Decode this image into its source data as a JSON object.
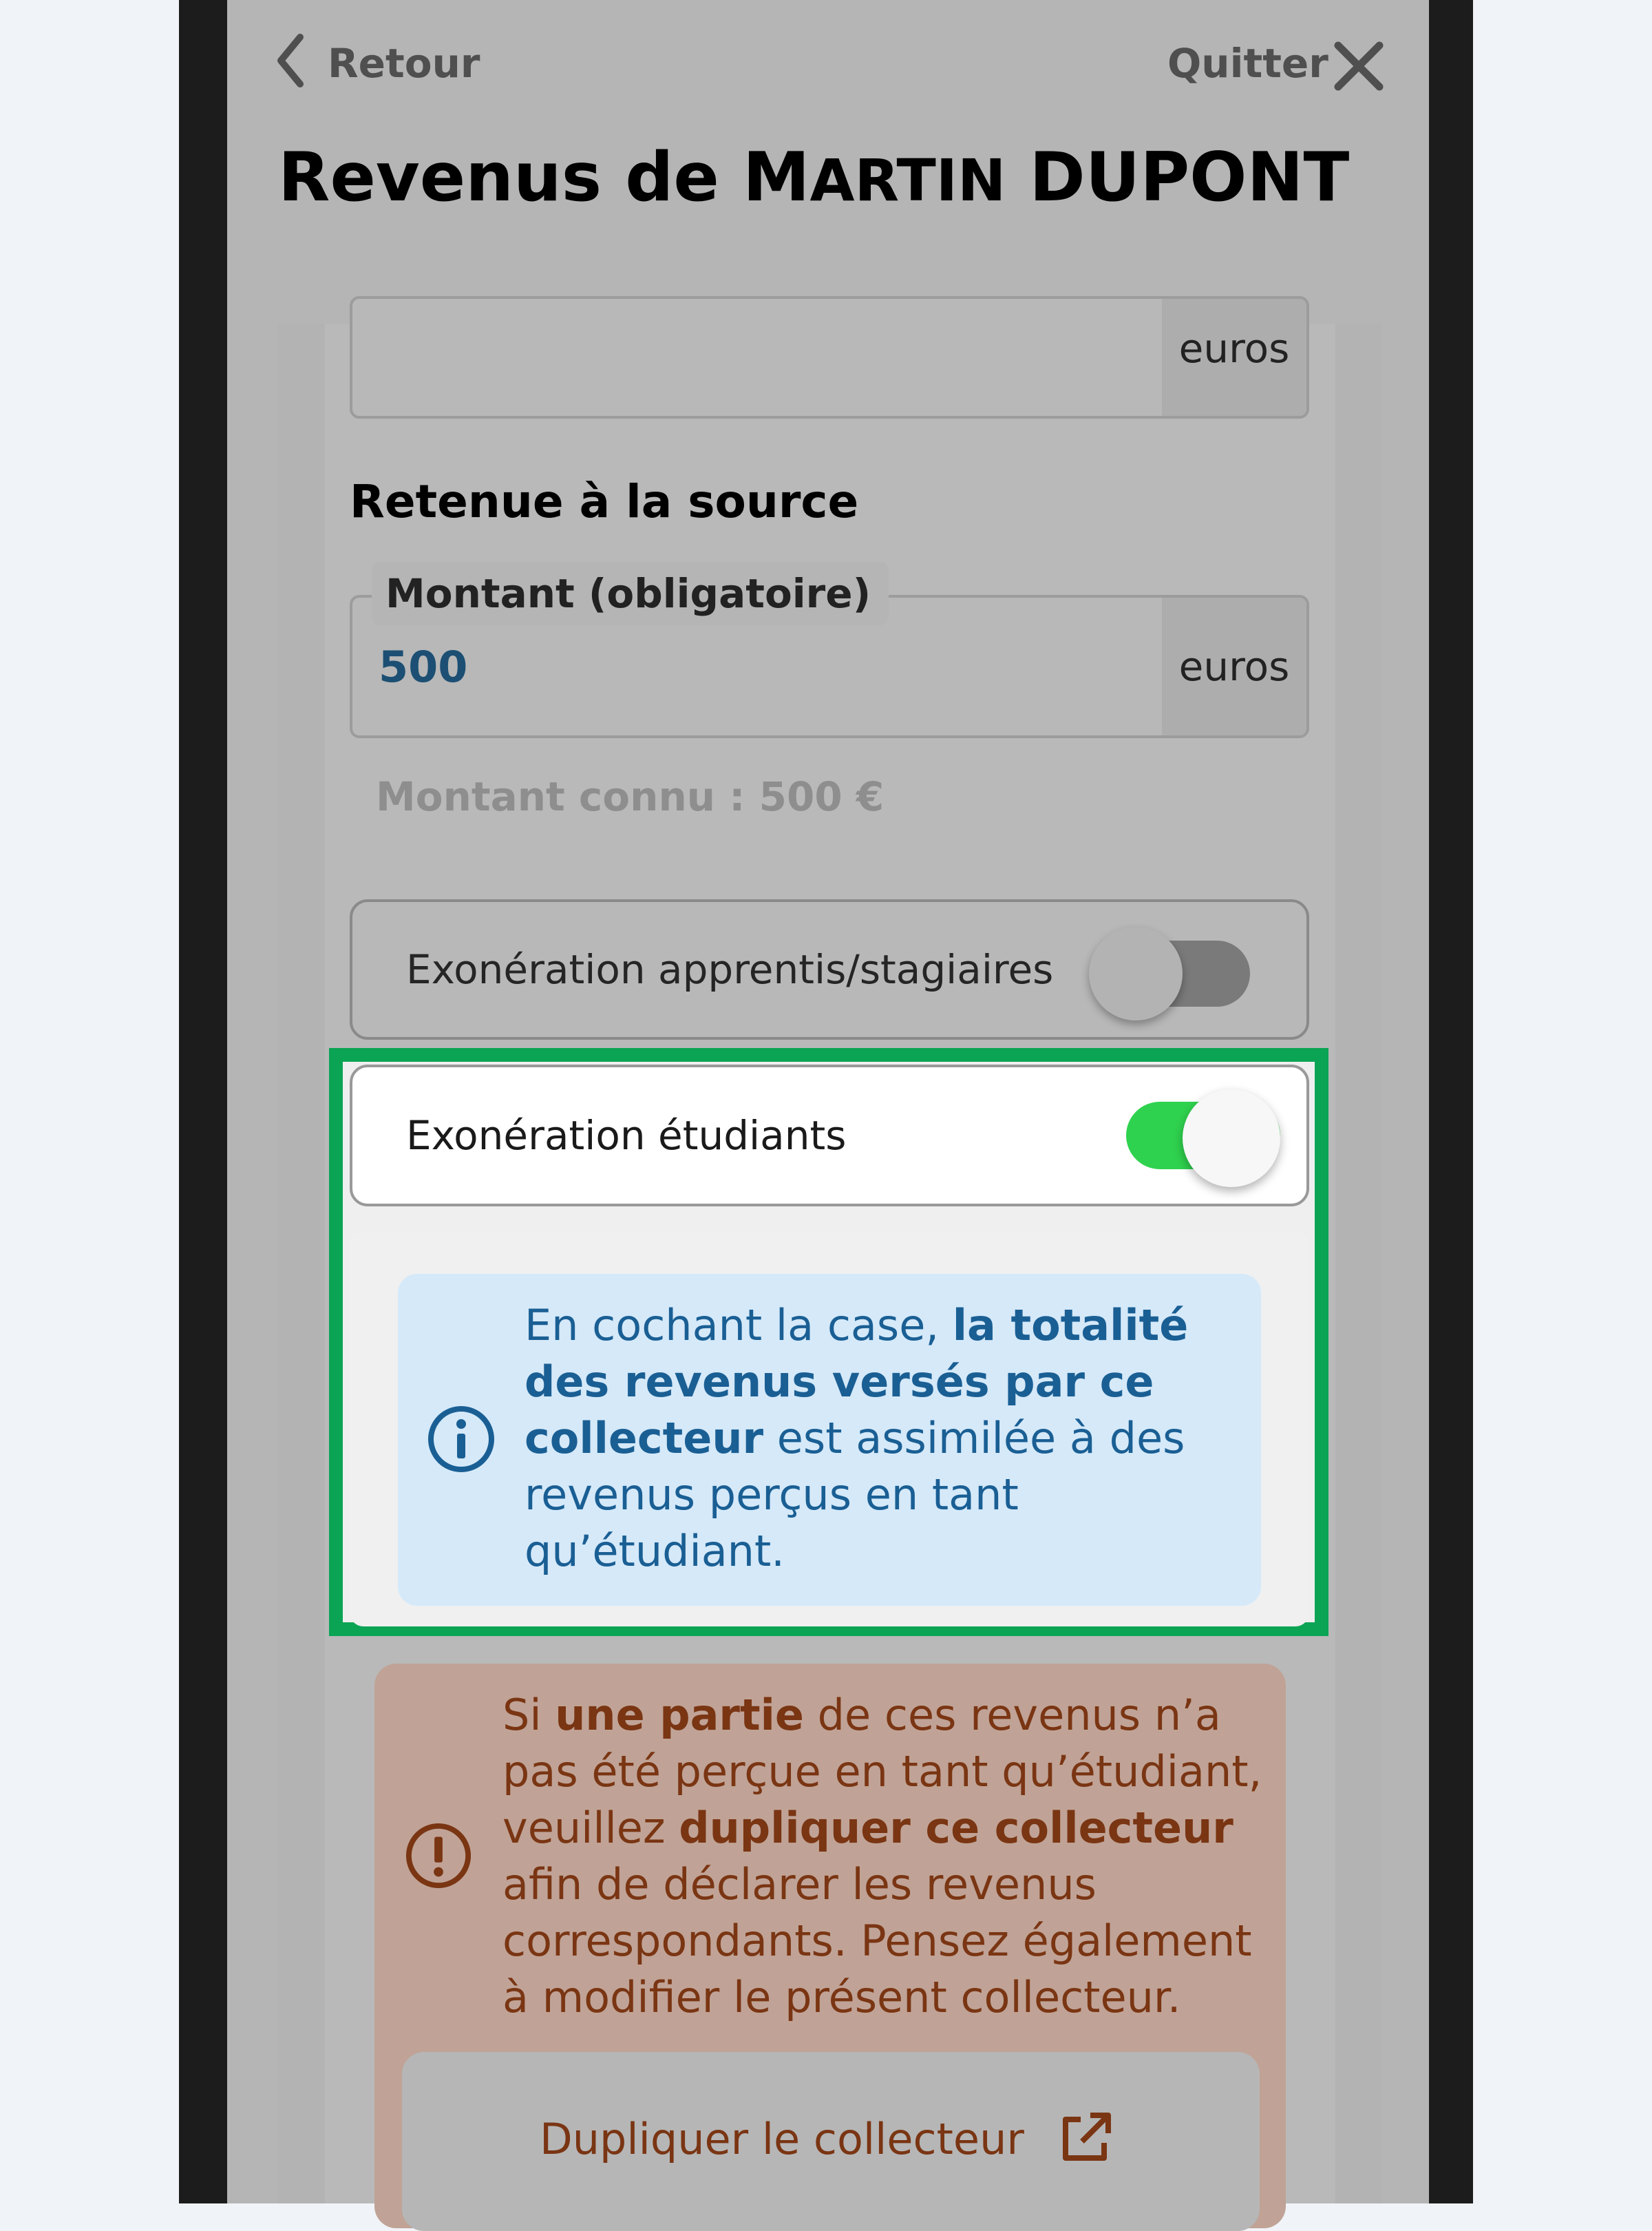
{
  "header": {
    "back_label": "Retour",
    "quit_label": "Quitter",
    "title_prefix": "Revenus de ",
    "title_first_initial": "M",
    "title_first_rest": "ARTIN",
    "title_last": " DUPONT"
  },
  "fields": {
    "unit": "euros",
    "section_title": "Retenue à la source",
    "amount_label": "Montant (obligatoire)",
    "amount_value": "500",
    "known_amount": "Montant connu : 500 €"
  },
  "toggles": [
    {
      "label": "Exonération apprentis/stagiaires",
      "on": false
    },
    {
      "label": "Exonération étudiants",
      "on": true
    }
  ],
  "info": {
    "t1": "En cochant la case, ",
    "b1": "la totalité des revenus versés par ce collecteur",
    "t2": " est assimilée à des revenus perçus en tant qu’étudiant."
  },
  "warning": {
    "t1": "Si ",
    "b1": "une partie",
    "t2": " de ces revenus n’a pas été perçue en tant qu’étudiant, veuillez ",
    "b2": "dupliquer ce collecteur",
    "t3": " afin de déclarer les revenus correspondants. Pensez également à modifier le présent collecteur."
  },
  "duplicate_button": "Dupliquer le collecteur",
  "colors": {
    "highlight": "#0ba454",
    "toggle_on": "#2fd24e",
    "info_text": "#1a5f94",
    "warning_text": "#7a3513"
  }
}
